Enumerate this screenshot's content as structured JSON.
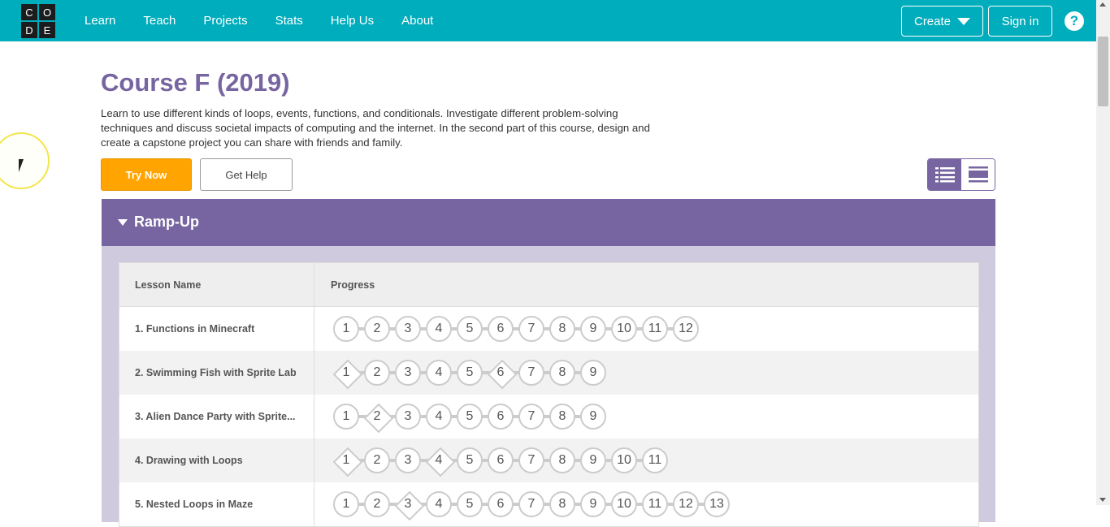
{
  "header": {
    "logo_letters": [
      "C",
      "O",
      "D",
      "E"
    ],
    "nav": [
      "Learn",
      "Teach",
      "Projects",
      "Stats",
      "Help Us",
      "About"
    ],
    "create_label": "Create",
    "signin_label": "Sign in",
    "help_icon": "?"
  },
  "course": {
    "title": "Course F (2019)",
    "description": "Learn to use different kinds of loops, events, functions, and conditionals. Investigate different problem-solving techniques and discuss societal impacts of computing and the internet. In the second part of this course, design and create a capstone project you can share with friends and family.",
    "try_now_label": "Try Now",
    "get_help_label": "Get Help"
  },
  "section": {
    "title": "Ramp-Up",
    "col_lesson": "Lesson Name",
    "col_progress": "Progress",
    "lessons": [
      {
        "name": "1. Functions in Minecraft",
        "levels": [
          1,
          2,
          3,
          4,
          5,
          6,
          7,
          8,
          9,
          10,
          11,
          12
        ],
        "diamonds": []
      },
      {
        "name": "2. Swimming Fish with Sprite Lab",
        "levels": [
          1,
          2,
          3,
          4,
          5,
          6,
          7,
          8,
          9
        ],
        "diamonds": [
          1,
          6
        ]
      },
      {
        "name": "3. Alien Dance Party with Sprite...",
        "levels": [
          1,
          2,
          3,
          4,
          5,
          6,
          7,
          8,
          9
        ],
        "diamonds": [
          2
        ]
      },
      {
        "name": "4. Drawing with Loops",
        "levels": [
          1,
          2,
          3,
          4,
          5,
          6,
          7,
          8,
          9,
          10,
          11
        ],
        "diamonds": [
          1,
          4
        ]
      },
      {
        "name": "5. Nested Loops in Maze",
        "levels": [
          1,
          2,
          3,
          4,
          5,
          6,
          7,
          8,
          9,
          10,
          11,
          12,
          13
        ],
        "diamonds": [
          3
        ]
      }
    ]
  },
  "colors": {
    "header_bg": "#00adbc",
    "accent_purple": "#7665a0",
    "try_now": "#ffa400"
  }
}
